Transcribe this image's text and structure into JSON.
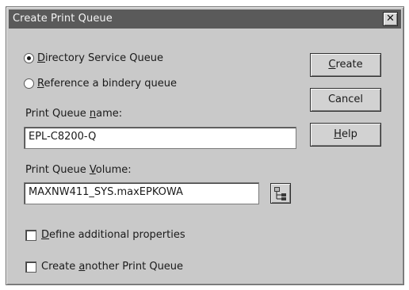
{
  "window": {
    "title": "Create Print Queue",
    "close_symbol": "✕"
  },
  "queue_type": {
    "options": [
      {
        "label_hot": "D",
        "label_rest": "irectory Service Queue",
        "selected": true
      },
      {
        "label_hot": "R",
        "label_rest": "eference a bindery queue",
        "selected": false
      }
    ]
  },
  "queue_name": {
    "label_pre": "Print Queue ",
    "label_hot": "n",
    "label_post": "ame:",
    "value": "EPL-C8200-Q"
  },
  "queue_volume": {
    "label_pre": "Print Queue ",
    "label_hot": "V",
    "label_post": "olume:",
    "value": "MAXNW411_SYS.maxEPKOWA",
    "browse_icon": "directory-tree-icon"
  },
  "options": [
    {
      "label_hot": "D",
      "label_rest": "efine additional properties",
      "checked": false
    },
    {
      "label_pre": "Create ",
      "label_hot": "a",
      "label_rest": "nother Print Queue",
      "checked": false
    }
  ],
  "buttons": {
    "create": {
      "hot": "C",
      "rest": "reate"
    },
    "cancel": {
      "label": "Cancel"
    },
    "help": {
      "hot": "H",
      "rest": "elp"
    }
  }
}
